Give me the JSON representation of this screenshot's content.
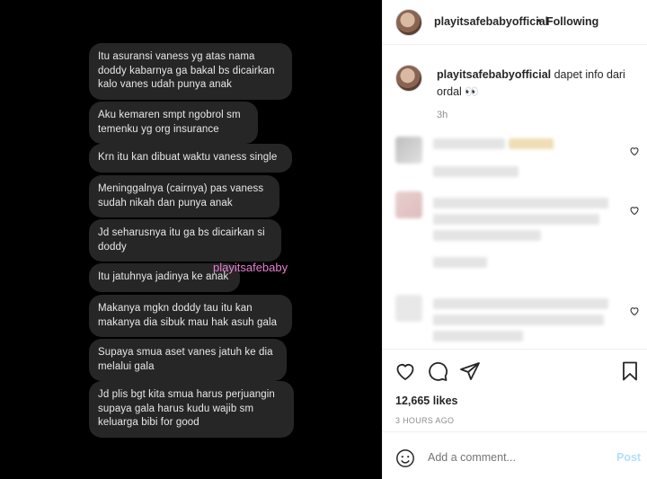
{
  "media": {
    "messages": [
      "Itu asuransi vaness yg atas nama doddy kabarnya ga bakal bs dicairkan kalo vanes udah punya anak",
      "Aku kemaren smpt ngobrol sm temenku yg org insurance",
      "Krn itu kan dibuat waktu vaness single",
      "Meninggalnya (cairnya) pas vaness sudah nikah dan punya anak",
      "Jd seharusnya itu ga bs dicairkan si doddy",
      "Itu jatuhnya jadinya ke anak",
      "Makanya mgkn doddy tau itu kan makanya dia sibuk mau hak asuh gala",
      "Supaya smua aset vanes jatuh ke dia melalui gala",
      "Jd plis bgt kita smua harus perjuangin supaya gala harus kudu wajib sm keluarga bibi for good"
    ],
    "watermark": "playitsafebaby"
  },
  "header": {
    "username": "playitsafebabyofficial",
    "separator": "•",
    "follow_status": "Following"
  },
  "caption": {
    "username": "playitsafebabyofficial",
    "text": "dapet info dari ordal 👀",
    "time": "3h"
  },
  "post_stats": {
    "likes": "12,665 likes",
    "posted_ago": "3 HOURS AGO"
  },
  "comment_box": {
    "placeholder": "Add a comment...",
    "post_label": "Post"
  },
  "icons": [
    "heart-icon",
    "comment-icon",
    "share-icon",
    "bookmark-icon",
    "emoji-icon"
  ],
  "colors": {
    "watermark": "#e77fd2",
    "post_button": "#b2dffc",
    "bubble": "#262626"
  }
}
